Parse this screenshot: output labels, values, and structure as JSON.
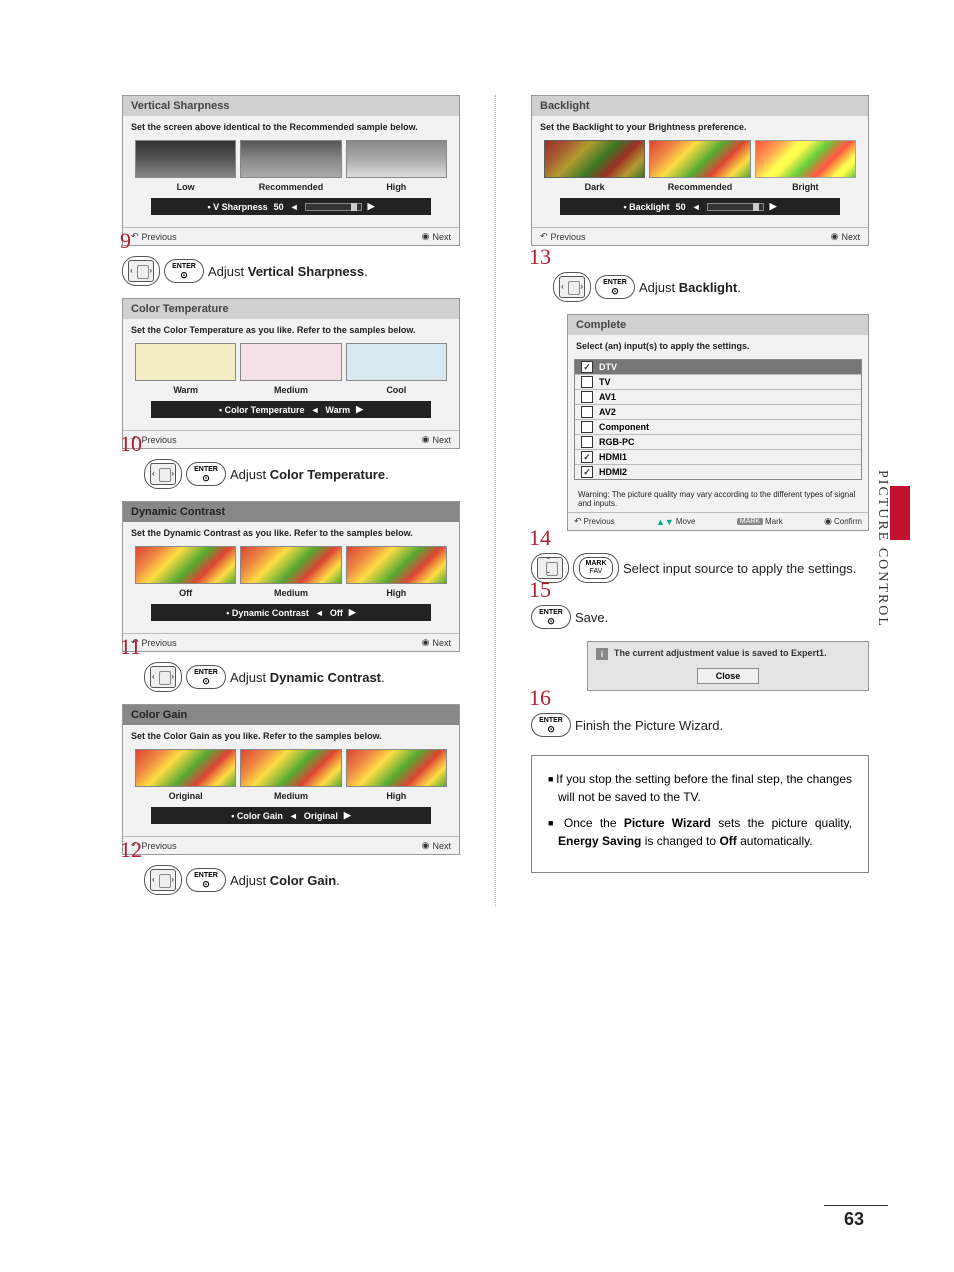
{
  "sideTab": "PICTURE CONTROL",
  "pageNum": "63",
  "panels": {
    "vsharp": {
      "title": "Vertical Sharpness",
      "sub": "Set the screen above identical to the Recommended sample below.",
      "labels": [
        "Low",
        "Recommended",
        "High"
      ],
      "slider": "• V Sharpness",
      "val": "50"
    },
    "ctemp": {
      "title": "Color Temperature",
      "sub": "Set the Color Temperature as you like. Refer to the samples below.",
      "labels": [
        "Warm",
        "Medium",
        "Cool"
      ],
      "slider": "• Color Temperature",
      "val": "Warm"
    },
    "dcon": {
      "title": "Dynamic Contrast",
      "sub": "Set the Dynamic Contrast as you like. Refer to the samples below.",
      "labels": [
        "Off",
        "Medium",
        "High"
      ],
      "slider": "• Dynamic Contrast",
      "val": "Off"
    },
    "cgain": {
      "title": "Color Gain",
      "sub": "Set the Color Gain as you like. Refer to the samples below.",
      "labels": [
        "Original",
        "Medium",
        "High"
      ],
      "slider": "• Color Gain",
      "val": "Original"
    },
    "backl": {
      "title": "Backlight",
      "sub": "Set the Backlight to your Brightness preference.",
      "labels": [
        "Dark",
        "Recommended",
        "Bright"
      ],
      "slider": "• Backlight",
      "val": "50"
    },
    "complete": {
      "title": "Complete",
      "sub": "Select (an) input(s) to apply the settings.",
      "warn": "Warning: The picture quality may vary according to the different types of signal and inputs.",
      "inputs": [
        {
          "name": "DTV",
          "checked": true,
          "sel": true
        },
        {
          "name": "TV",
          "checked": false
        },
        {
          "name": "AV1",
          "checked": false
        },
        {
          "name": "AV2",
          "checked": false
        },
        {
          "name": "Component",
          "checked": false
        },
        {
          "name": "RGB-PC",
          "checked": false
        },
        {
          "name": "HDMI1",
          "checked": true
        },
        {
          "name": "HDMI2",
          "checked": true
        }
      ]
    }
  },
  "footer": {
    "prev": "Previous",
    "next": "Next",
    "move": "Move",
    "mark": "Mark",
    "confirm": "Confirm",
    "markChip": "MARK"
  },
  "steps": {
    "s9": {
      "num": "9",
      "pre": "Adjust ",
      "b": "Vertical Sharpness",
      "post": "."
    },
    "s10": {
      "num": "10",
      "pre": "Adjust ",
      "b": "Color Temperature",
      "post": "."
    },
    "s11": {
      "num": "11",
      "pre": "Adjust ",
      "b": "Dynamic Contrast",
      "post": "."
    },
    "s12": {
      "num": "12",
      "pre": "Adjust ",
      "b": "Color Gain",
      "post": "."
    },
    "s13": {
      "num": "13",
      "pre": "Adjust ",
      "b": "Backlight",
      "post": "."
    },
    "s14": {
      "num": "14",
      "text": "Select input source to apply the settings."
    },
    "s15": {
      "num": "15",
      "text": "Save."
    },
    "s16": {
      "num": "16",
      "text": "Finish the Picture Wizard."
    }
  },
  "btn": {
    "enter": "ENTER",
    "mark": "MARK",
    "fav": "FAV"
  },
  "savebox": {
    "msg": "The current adjustment value is saved to Expert1.",
    "close": "Close"
  },
  "notes": {
    "n1a": "If you stop the setting before the final step, the changes will not be saved to the TV.",
    "n2a": "Once the ",
    "n2b": "Picture Wizard",
    "n2c": " sets the pic­ture quality, ",
    "n2d": "Energy Saving",
    "n2e": " is changed to ",
    "n2f": "Off",
    "n2g": " automatically."
  }
}
